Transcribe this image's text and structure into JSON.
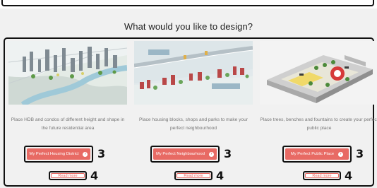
{
  "heading": "What would you like to design?",
  "cards": [
    {
      "description": "Place HDB and condos of different height and shape in the future residential area",
      "cta_label": "My Perfect Housing District",
      "annotation_cta": "3",
      "read_more": "Read more",
      "annotation_more": "4"
    },
    {
      "description": "Place housing blocks, shops and parks to make your perfect neighbourhood",
      "cta_label": "My Perfect Neighbourhood",
      "annotation_cta": "3",
      "read_more": "Read more",
      "annotation_more": "4"
    },
    {
      "description": "Place trees, benches and fountains to create your perfect public place",
      "cta_label": "My Perfect Public Place",
      "annotation_cta": "3",
      "read_more": "Read more",
      "annotation_more": "4"
    }
  ],
  "colors": {
    "accent": "#e86a64",
    "annotation_border": "#111111",
    "background": "#f1f1f1"
  },
  "icons": {
    "cta_icon": "arrow-circle-right-icon"
  }
}
